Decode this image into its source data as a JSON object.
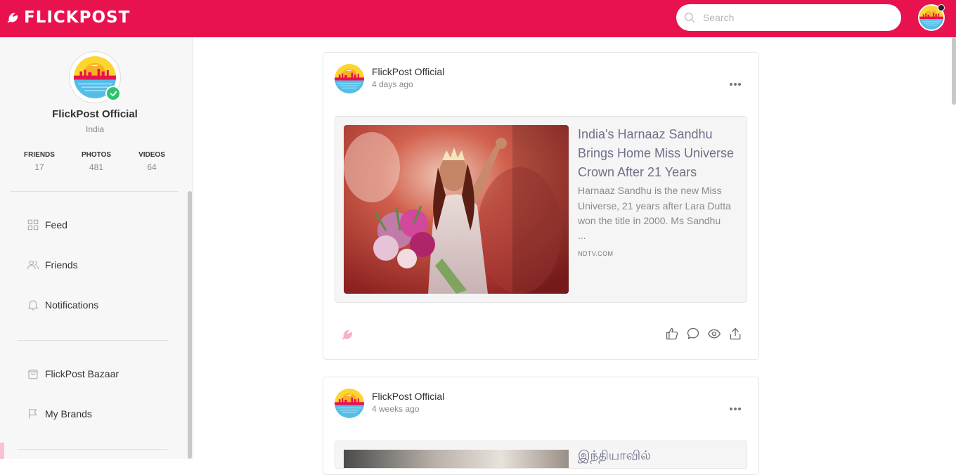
{
  "app": {
    "brand_name": "FLICKPOST",
    "accent_color": "#e8124f"
  },
  "header": {
    "search_placeholder": "Search"
  },
  "profile": {
    "name": "FlickPost Official",
    "location": "India",
    "stats": [
      {
        "label": "FRIENDS",
        "value": "17"
      },
      {
        "label": "PHOTOS",
        "value": "481"
      },
      {
        "label": "VIDEOS",
        "value": "64"
      }
    ]
  },
  "sidebar": {
    "items": [
      {
        "label": "Feed",
        "icon": "grid-icon"
      },
      {
        "label": "Friends",
        "icon": "users-icon"
      },
      {
        "label": "Notifications",
        "icon": "bell-icon"
      },
      {
        "label": "FlickPost Bazaar",
        "icon": "shopping-bag-icon"
      },
      {
        "label": "My Brands",
        "icon": "flag-icon"
      }
    ]
  },
  "posts": [
    {
      "author": "FlickPost Official",
      "time": "4 days ago",
      "link": {
        "title": "India's Harnaaz Sandhu Brings Home Miss Universe Crown After 21 Years",
        "description": "Harnaaz Sandhu is the new Miss Universe, 21 years after Lara Dutta won the title in 2000. Ms Sandhu",
        "ellipsis": "...",
        "source": "NDTV.COM"
      },
      "actions": [
        "like-icon",
        "comment-icon",
        "view-icon",
        "share-icon"
      ]
    },
    {
      "author": "FlickPost Official",
      "time": "4 weeks ago",
      "link": {
        "title": "இந்தியாவில்"
      }
    }
  ]
}
